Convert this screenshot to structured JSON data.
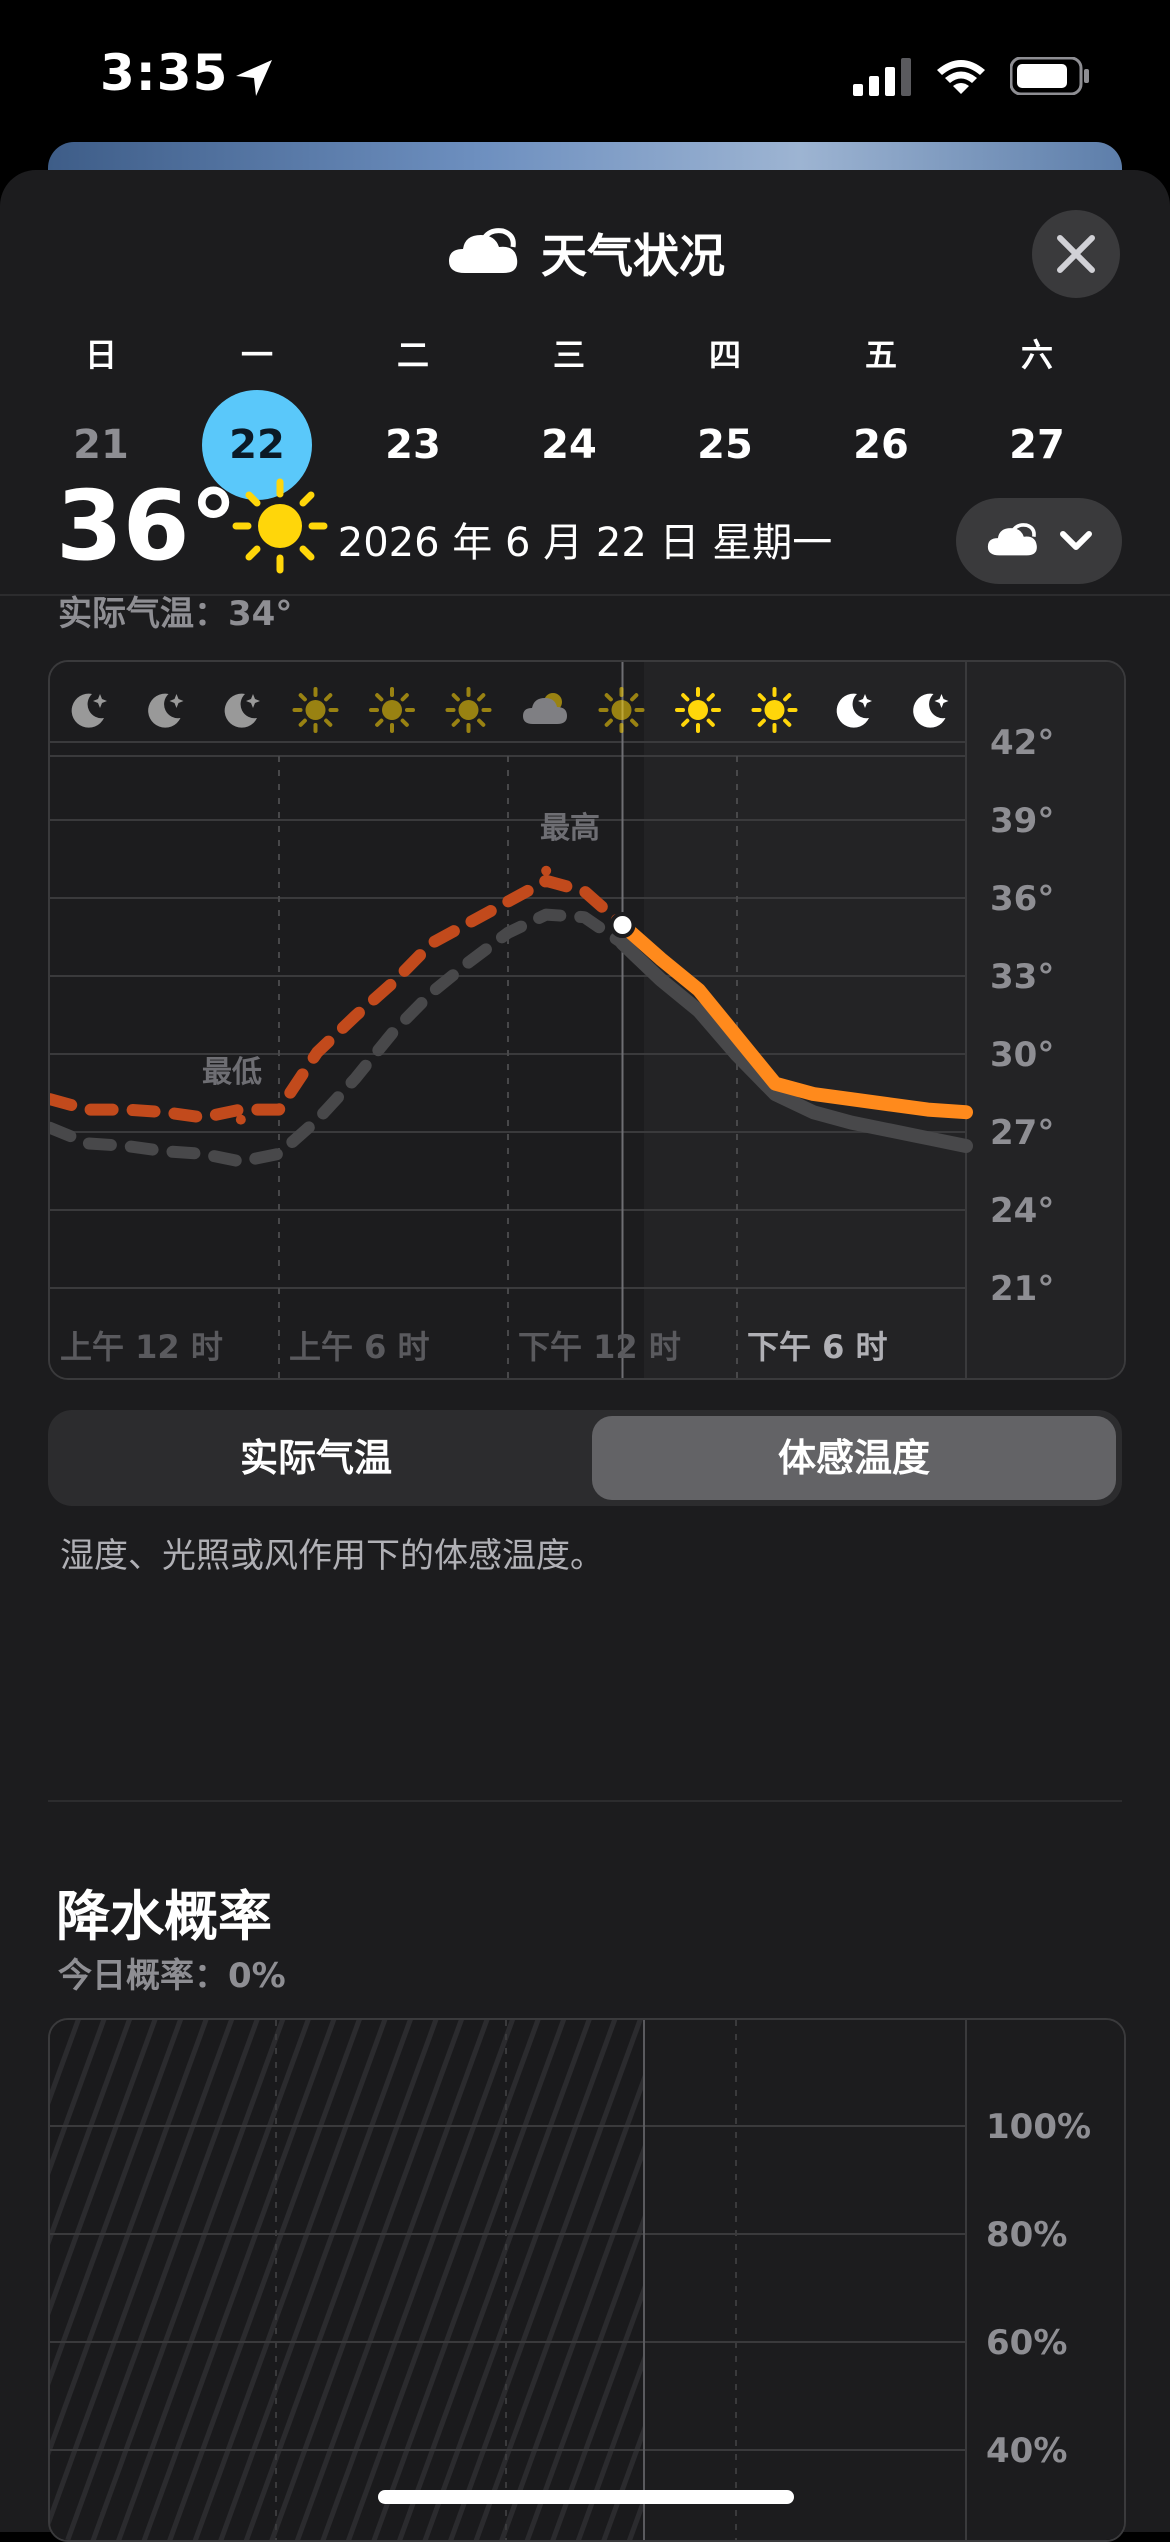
{
  "status_bar": {
    "time": "3:35",
    "icons": [
      "location-arrow-icon",
      "signal-icon",
      "wifi-icon",
      "battery-icon"
    ]
  },
  "header": {
    "title": "天气状况",
    "icon": "cloud-icon",
    "close_icon": "close-icon"
  },
  "week": {
    "names": [
      "日",
      "一",
      "二",
      "三",
      "四",
      "五",
      "六"
    ],
    "dates": [
      "21",
      "22",
      "23",
      "24",
      "25",
      "26",
      "27"
    ],
    "selected_index": 1,
    "selected_color": "#5ac8fa"
  },
  "date_line": "2026 年 6 月 22 日 星期一",
  "current": {
    "temp": "36°",
    "actual_label": "实际气温：34°",
    "icon": "sun-icon"
  },
  "condition_button": {
    "icon": "cloud-icon",
    "chevron": "chevron-down-icon"
  },
  "temp_chart": {
    "hour_icons": [
      "moon-star-icon",
      "moon-star-icon",
      "moon-star-icon",
      "sun-icon",
      "sun-icon",
      "sun-icon",
      "partly-cloudy-icon",
      "sun-icon",
      "sun-icon",
      "sun-icon",
      "moon-star-icon",
      "moon-star-icon"
    ],
    "y_labels": [
      "42°",
      "39°",
      "36°",
      "33°",
      "30°",
      "27°",
      "24°",
      "21°"
    ],
    "x_labels": [
      "上午 12 时",
      "上午 6 时",
      "下午 12 时",
      "下午 6 时"
    ],
    "low_label": "最低",
    "high_label": "最高"
  },
  "chart_data": {
    "type": "line",
    "x": [
      0,
      1,
      2,
      3,
      4,
      5,
      6,
      7,
      8,
      9,
      10,
      11,
      12,
      13,
      14,
      15,
      16,
      17,
      18,
      19,
      20,
      21,
      22,
      23,
      24
    ],
    "xlabel": "",
    "ylabel": "",
    "ylim": [
      21,
      42
    ],
    "series": [
      {
        "values": [
          28.8,
          28.4,
          28.4,
          28.3,
          28.1,
          28.4,
          28.4,
          30.6,
          32.0,
          33.3,
          34.8,
          35.6,
          36.4,
          37.2,
          36.8,
          35.5,
          34.2,
          33.0,
          31.2,
          29.4,
          29.0,
          28.8,
          28.6,
          28.4,
          28.3
        ]
      },
      {
        "values": [
          27.7,
          27.1,
          27.0,
          26.8,
          26.7,
          26.4,
          26.7,
          28.0,
          29.6,
          31.4,
          32.9,
          34.1,
          35.2,
          35.9,
          35.8,
          34.8,
          33.4,
          32.2,
          30.5,
          29.0,
          28.3,
          27.9,
          27.6,
          27.3,
          27.0
        ]
      }
    ],
    "colors": {
      "feels_like_past": "#c24a1c",
      "feels_like_future": "#ff8a1c",
      "actual": "#48484a"
    },
    "grid": true,
    "current_hour": 15
  },
  "segmented": {
    "options": [
      "实际气温",
      "体感温度"
    ],
    "selected_index": 1
  },
  "note": "湿度、光照或风作用下的体感温度。",
  "precip": {
    "title": "降水概率",
    "subtitle": "今日概率：0%",
    "y_labels": [
      "100%",
      "80%",
      "60%",
      "40%"
    ]
  }
}
